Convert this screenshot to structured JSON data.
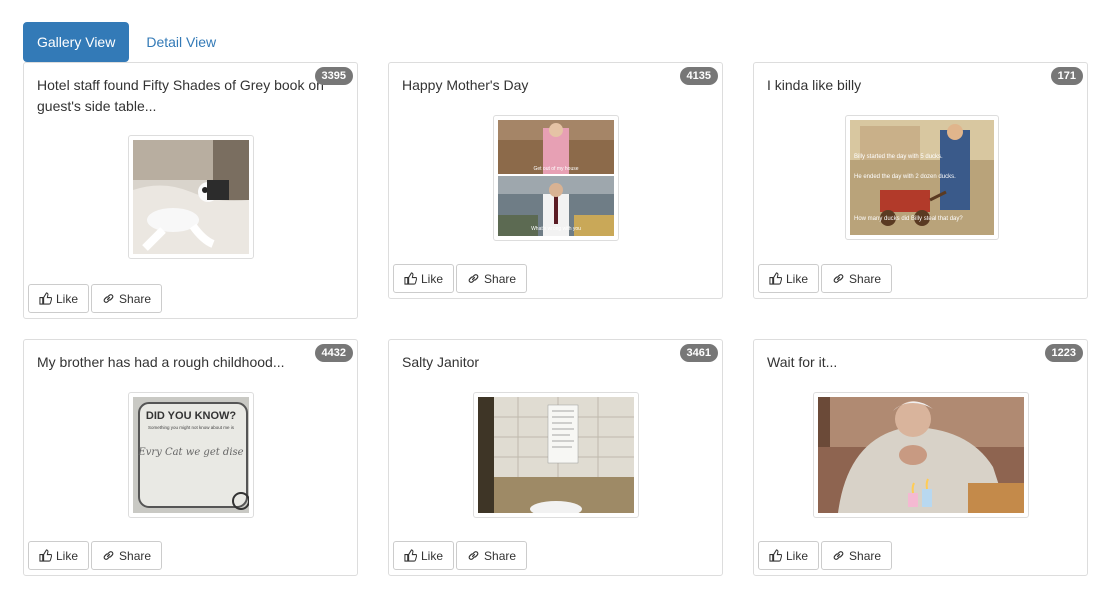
{
  "tabs": {
    "gallery": "Gallery View",
    "detail": "Detail View"
  },
  "accent_color": "#337ab7",
  "badge_color": "#777777",
  "buttons": {
    "like": "Like",
    "share": "Share",
    "like_icon": "thumbs-up-icon",
    "share_icon": "link-icon"
  },
  "cards": [
    {
      "title": "Hotel staff found Fifty Shades of Grey book on guest's side table...",
      "count": "3395",
      "image": "towel-animal-on-bed"
    },
    {
      "title": "Happy Mother's Day",
      "count": "4135",
      "image": "tv-show-two-panel-meme"
    },
    {
      "title": "I kinda like billy",
      "count": "171",
      "image": "vintage-illustration-boy-with-wagon"
    },
    {
      "title": "My brother has had a rough childhood...",
      "count": "4432",
      "image": "did-you-know-worksheet"
    },
    {
      "title": "Salty Janitor",
      "count": "3461",
      "image": "bathroom-wall-with-note"
    },
    {
      "title": "Wait for it...",
      "count": "1223",
      "image": "elderly-woman-with-birthday-candles"
    }
  ],
  "image_text": {
    "worksheet_heading": "DID YOU KNOW?",
    "worksheet_sub": "Something you might not know about me is",
    "worksheet_answer": "Evry Cat we get dise",
    "meme_top": "Get out of my house",
    "meme_bottom": "What's wrong with you",
    "billy_1": "Billy started the day with 5 ducks.",
    "billy_2": "He ended the day with 2 dozen ducks.",
    "billy_3": "How many ducks did Billy steal that day?"
  }
}
